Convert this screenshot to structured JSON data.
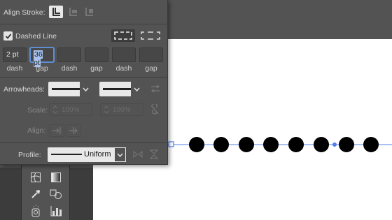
{
  "panel": {
    "align_stroke_label": "Align Stroke:",
    "dashed_line_label": "Dashed Line",
    "dashed_line_checked": true,
    "dash_values": [
      "2 pt",
      "36 pt",
      "",
      "",
      "",
      ""
    ],
    "dash_labels": [
      "dash",
      "gap",
      "dash",
      "gap",
      "dash",
      "gap"
    ],
    "arrowheads_label": "Arrowheads:",
    "scale_label": "Scale:",
    "scale_start": "100%",
    "scale_end": "100%",
    "align_label": "Align:",
    "profile_label": "Profile:",
    "profile_value": "Uniform"
  },
  "colors": {
    "panel_bg": "#535353",
    "canvas": "#ffffff",
    "path_blue": "#4f7fe8",
    "dots": "#000000"
  },
  "icons": {
    "align_stroke": [
      "align-center-icon",
      "align-inside-icon",
      "align-outside-icon"
    ],
    "dash_modes": [
      "dash-preserve-icon",
      "dash-align-corners-icon"
    ],
    "tools": [
      "mesh-tool-icon",
      "gradient-tool-icon",
      "eyedropper-tool-icon",
      "blend-tool-icon",
      "symbol-sprayer-tool-icon",
      "column-graph-tool-icon"
    ]
  }
}
